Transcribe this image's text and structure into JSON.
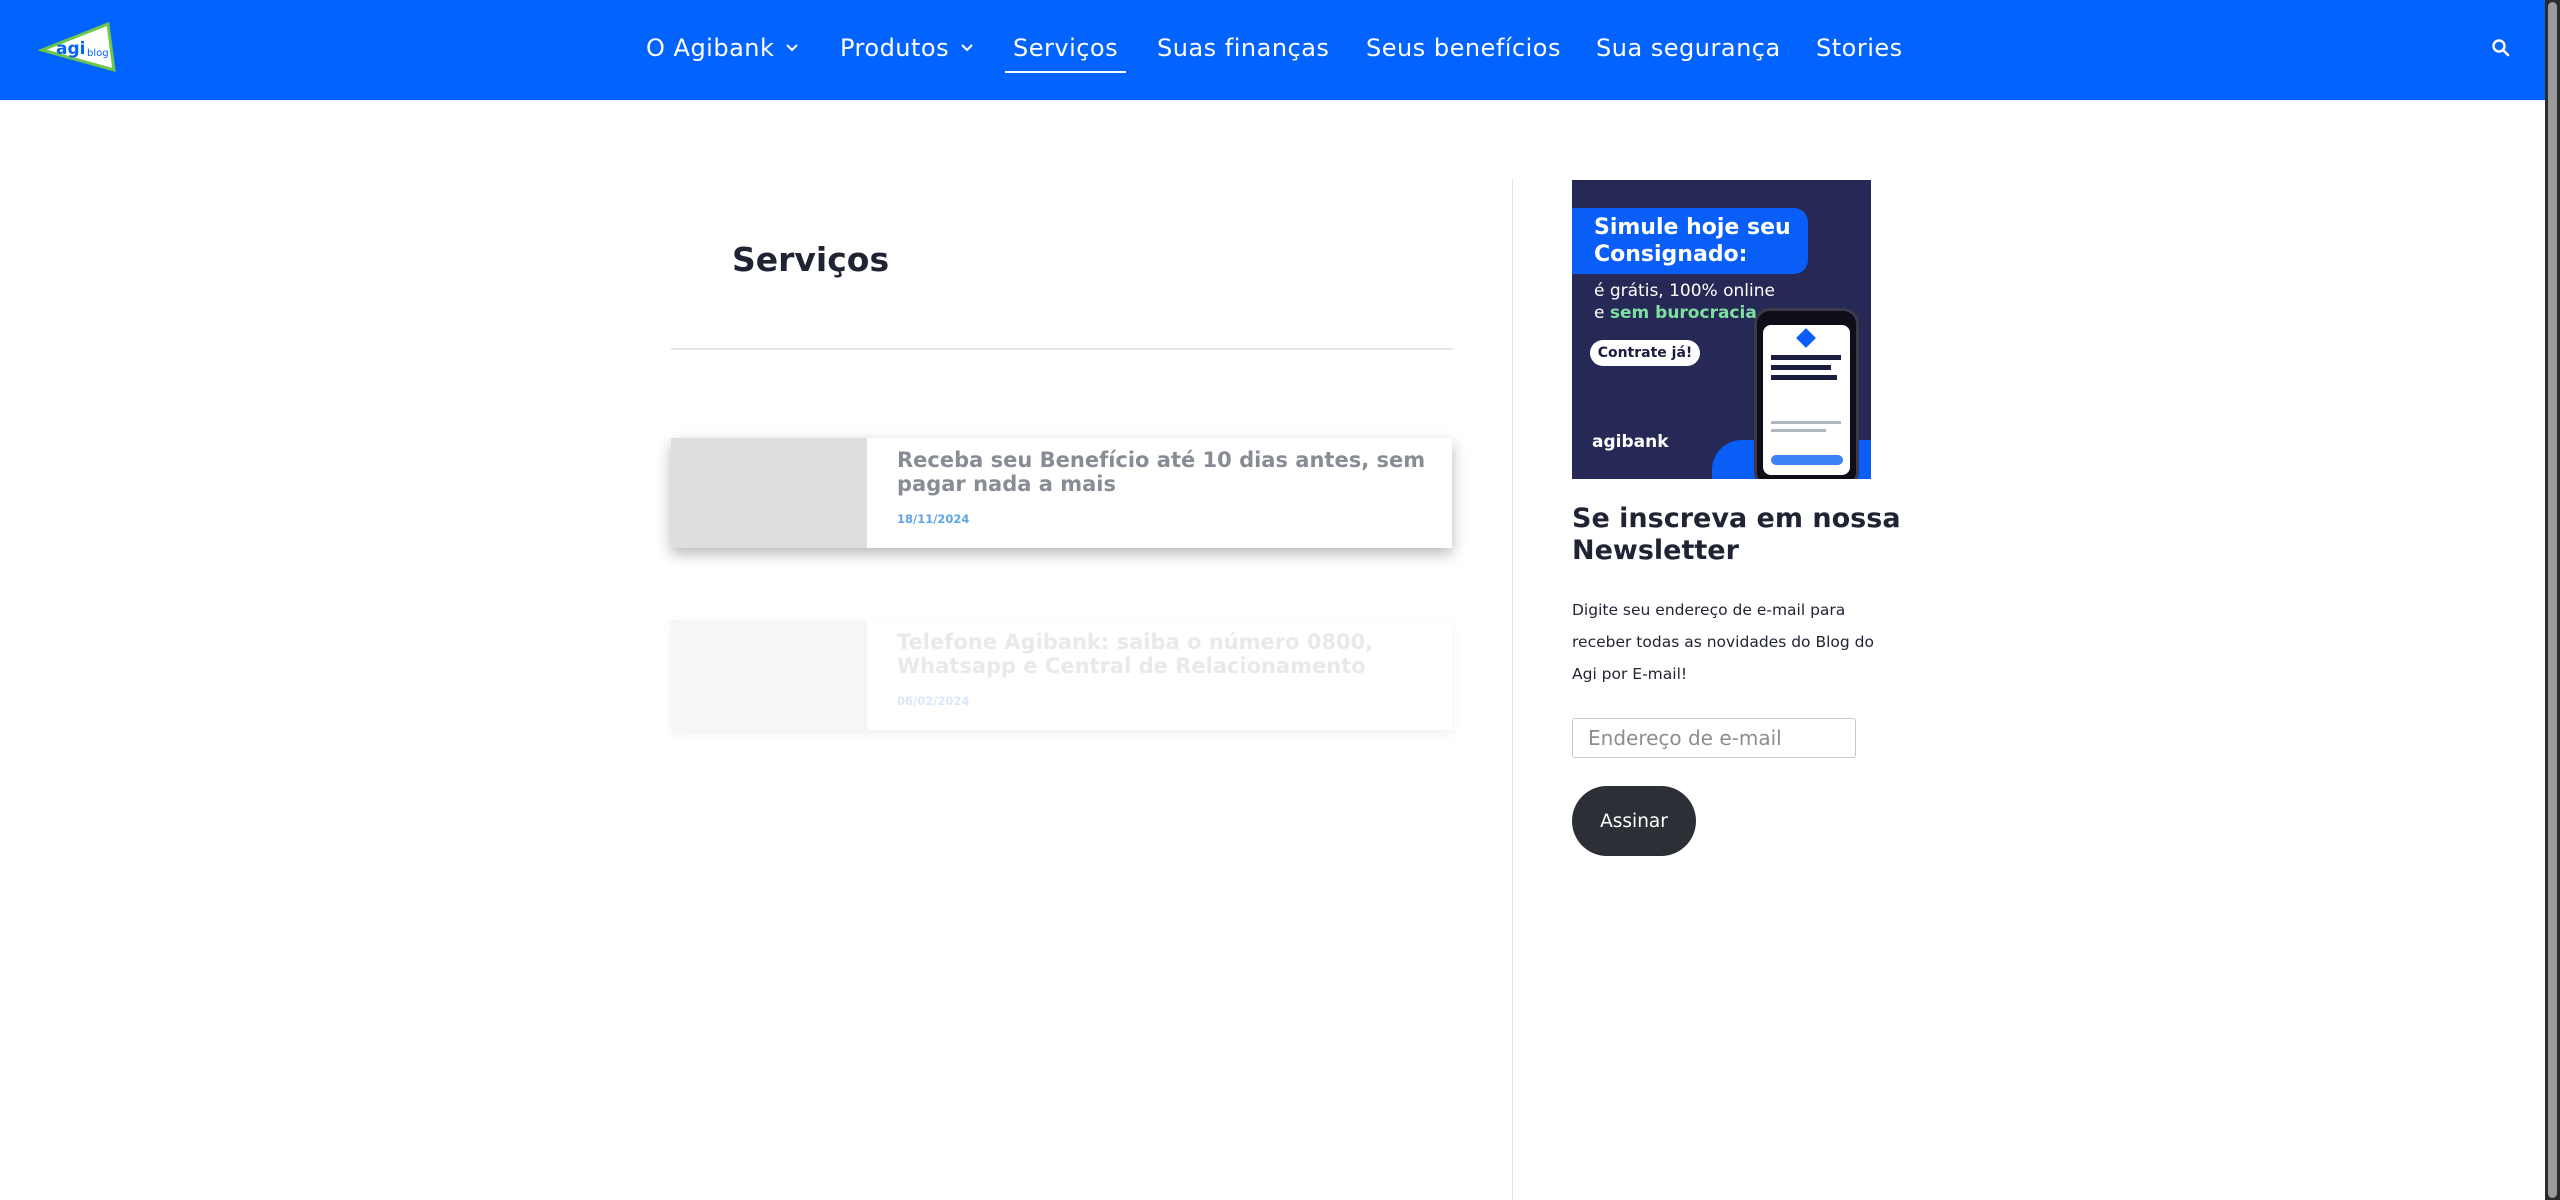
{
  "header": {
    "logo_text": "agi",
    "logo_sub": "blog",
    "nav": [
      {
        "label": "O Agibank",
        "has_dropdown": true
      },
      {
        "label": "Produtos",
        "has_dropdown": true
      },
      {
        "label": "Serviços",
        "active": true
      },
      {
        "label": "Suas finanças"
      },
      {
        "label": "Seus benefícios"
      },
      {
        "label": "Sua segurança"
      },
      {
        "label": "Stories"
      }
    ],
    "search_icon": "search-icon"
  },
  "main": {
    "page_title": "Serviços",
    "posts": [
      {
        "title": "Receba seu Benefício até 10 dias antes, sem pagar nada a mais",
        "date": "18/11/2024"
      },
      {
        "title": "Telefone Agibank: saiba o número 0800, Whatsapp e Central de Relacionamento",
        "date": "06/02/2024"
      }
    ]
  },
  "sidebar": {
    "ad": {
      "headline": "Simule hoje seu Consignado:",
      "sub_line1": "é grátis, 100% online",
      "sub_prefix": "e ",
      "sub_highlight": "sem burocracia.",
      "cta": "Contrate já!",
      "brand": "agibank"
    },
    "newsletter": {
      "title": "Se inscreva em nossa Newsletter",
      "description": "Digite seu endereço de e-mail para receber todas as novidades do Blog do Agi por E-mail!",
      "input_placeholder": "Endereço de e-mail",
      "button_label": "Assinar"
    }
  },
  "colors": {
    "header_bg": "#0363ff",
    "ad_bg": "#262855",
    "button_bg": "#2c2f36",
    "date": "#5fa3e8"
  }
}
